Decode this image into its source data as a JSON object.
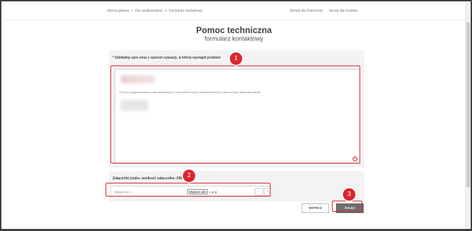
{
  "breadcrumb": [
    "Strona główna",
    "Dla użytkowników",
    "Formularz kontaktowy"
  ],
  "top_links": [
    "Serwis dla Partnerów",
    "Serwis dla mediów"
  ],
  "page": {
    "title": "Pomoc techniczna",
    "subtitle": "formularz kontaktowy"
  },
  "description": {
    "label": "* Dokładny opis wraz z opisem sytuacji, w której wystąpił problem",
    "text": "Proszę o wygenerowanie kodów serwisowych w celu zmiany danych właściciela licencji. Dane nowego właściciela licencji:"
  },
  "attachments": {
    "label": "Załączniki (maks. wielkość załącznika: 20MB)",
    "row_label": "Załącznik 1:",
    "file_button": "Wybierz plik",
    "file_name": "1.png",
    "minus": "-",
    "plus": "+"
  },
  "buttons": {
    "back": "WSTECZ",
    "next": "DALEJ"
  },
  "markers": [
    "1",
    "2",
    "3"
  ],
  "colors": {
    "accent": "#d9262c",
    "next_button": "#6e6e6e"
  }
}
